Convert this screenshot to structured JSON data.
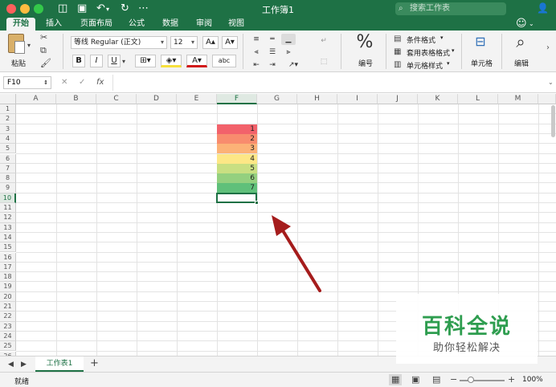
{
  "titlebar": {
    "title": "工作簿1",
    "search_placeholder": "搜索工作表",
    "icons": [
      "sidebar-icon",
      "save-icon",
      "undo-icon",
      "redo-icon",
      "more-icon",
      "search-icon",
      "add-user-icon"
    ]
  },
  "tabs": [
    "开始",
    "插入",
    "页面布局",
    "公式",
    "数据",
    "审阅",
    "视图"
  ],
  "ribbon": {
    "paste_label": "粘贴",
    "font_name": "等线 Regular (正文)",
    "font_size": "12",
    "bold": "B",
    "italic": "I",
    "underline": "U",
    "font_color_glyph": "A",
    "phonetic_glyph": "abc",
    "number_symbol": "%",
    "number_label": "编号",
    "conditional_format": "条件格式",
    "table_format": "套用表格格式",
    "cell_style": "单元格样式",
    "cells_label": "单元格",
    "editing_label": "编辑"
  },
  "formula_bar": {
    "name_box": "F10",
    "cancel_icon": "✕",
    "confirm_icon": "✓",
    "fx_label": "fx"
  },
  "grid": {
    "columns": [
      "A",
      "B",
      "C",
      "D",
      "E",
      "F",
      "G",
      "H",
      "I",
      "J",
      "K",
      "L",
      "M"
    ],
    "rows": [
      "1",
      "2",
      "3",
      "4",
      "5",
      "6",
      "7",
      "8",
      "9",
      "10",
      "11",
      "12",
      "13",
      "14",
      "15",
      "16",
      "17",
      "18",
      "19",
      "20",
      "21",
      "22",
      "23",
      "24",
      "25",
      "26"
    ],
    "selected_cell": "F10",
    "active_column": "F",
    "active_row": "10",
    "colored_cells": [
      {
        "row": 3,
        "value": "1",
        "color": "#f2626b"
      },
      {
        "row": 4,
        "value": "2",
        "color": "#f88c6e"
      },
      {
        "row": 5,
        "value": "3",
        "color": "#fcb277"
      },
      {
        "row": 6,
        "value": "4",
        "color": "#fde786"
      },
      {
        "row": 7,
        "value": "5",
        "color": "#c9df82"
      },
      {
        "row": 8,
        "value": "6",
        "color": "#94d07f"
      },
      {
        "row": 9,
        "value": "7",
        "color": "#5fc07a"
      }
    ]
  },
  "sheets": {
    "tabs": [
      "工作表1"
    ],
    "add_label": "+"
  },
  "status": {
    "ready_text": "就绪",
    "zoom": "100%",
    "zoom_minus": "−",
    "zoom_plus": "+"
  },
  "watermark": {
    "big": "百科全说",
    "small": "助你轻松解决"
  },
  "colors": {
    "excel_green": "#1e7145",
    "arrow": "#a51c1c",
    "watermark_green": "#2e9d4f"
  }
}
